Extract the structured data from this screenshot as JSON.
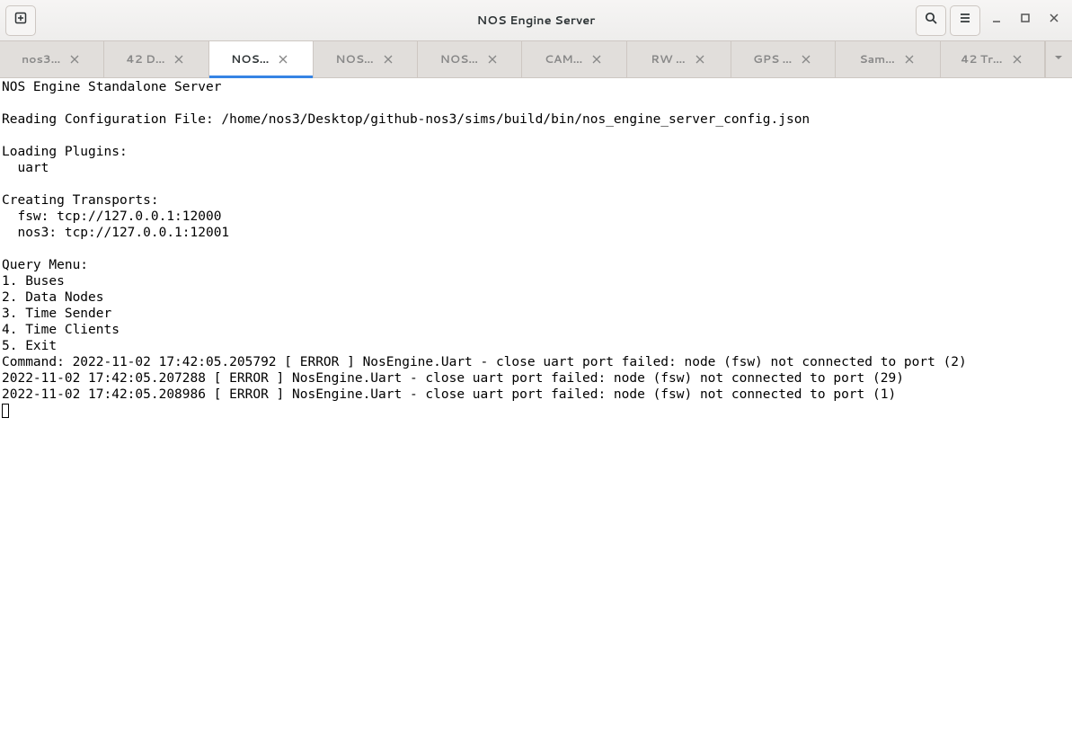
{
  "window": {
    "title": "NOS Engine Server"
  },
  "header_buttons": {
    "new_tab": "new-tab",
    "search": "search",
    "menu": "menu",
    "minimize": "minimize",
    "maximize": "maximize",
    "close": "close"
  },
  "tabs": [
    {
      "label": "nos3…",
      "active": false
    },
    {
      "label": "42 D…",
      "active": false
    },
    {
      "label": "NOS…",
      "active": true
    },
    {
      "label": "NOS…",
      "active": false
    },
    {
      "label": "NOS…",
      "active": false
    },
    {
      "label": "CAM…",
      "active": false
    },
    {
      "label": "RW …",
      "active": false
    },
    {
      "label": "GPS …",
      "active": false
    },
    {
      "label": "Sam…",
      "active": false
    },
    {
      "label": "42 Tr…",
      "active": false
    }
  ],
  "terminal": {
    "lines": [
      "NOS Engine Standalone Server",
      "",
      "Reading Configuration File: /home/nos3/Desktop/github-nos3/sims/build/bin/nos_engine_server_config.json",
      "",
      "Loading Plugins:",
      "  uart",
      "",
      "Creating Transports:",
      "  fsw: tcp://127.0.0.1:12000",
      "  nos3: tcp://127.0.0.1:12001",
      "",
      "Query Menu:",
      "1. Buses",
      "2. Data Nodes",
      "3. Time Sender",
      "4. Time Clients",
      "5. Exit",
      "Command: 2022-11-02 17:42:05.205792 [ ERROR ] NosEngine.Uart - close uart port failed: node (fsw) not connected to port (2)",
      "2022-11-02 17:42:05.207288 [ ERROR ] NosEngine.Uart - close uart port failed: node (fsw) not connected to port (29)",
      "2022-11-02 17:42:05.208986 [ ERROR ] NosEngine.Uart - close uart port failed: node (fsw) not connected to port (1)"
    ]
  }
}
